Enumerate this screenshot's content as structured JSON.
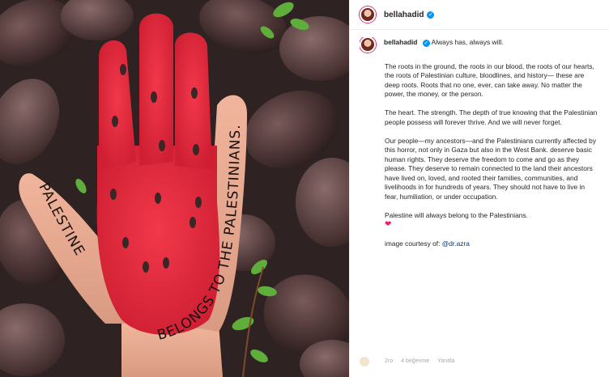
{
  "post": {
    "username": "bellahadid",
    "verified_glyph": "✓",
    "caption_intro": "Always has, always will.",
    "paragraphs": [
      "The roots in the ground, the roots in our blood, the roots of our hearts, the roots of Palestinian culture, bloodlines, and history— these are deep roots. Roots that no one, ever, can take away. No matter the power, the money, or the person.",
      "The heart. The strength. The depth of true knowing that the Palestinian people possess will forever thrive. And we will never forget.",
      "Our people—my ancestors—and the Palestinians currently affected by this horror, not only in Gaza but also in the West Bank. deserve basic human rights. They deserve the freedom to come and go as they please. They deserve to remain connected to the land their ancestors have lived on, loved, and rooted their families, communities, and livelihoods in for hundreds of years. They should not have to live in fear, humiliation, or under occupation.",
      "Palestine will always belong to the Palestinians."
    ],
    "heart_glyph": "❤",
    "credit_prefix": "image courtesy of: ",
    "credit_mention": "@dr.azra",
    "footer": {
      "time": "2ro",
      "likes": "4 beğenme",
      "reply": "Yanıtla"
    }
  },
  "photo": {
    "hand_text": "PALESTINE BELONGS TO THE PALESTINIANS."
  },
  "icons": {
    "verified": "verified-badge-icon",
    "heart": "heart-icon"
  },
  "colors": {
    "hand_red": "#e8263a",
    "verified_blue": "#0095f6",
    "leaf_dark": "#4a3333"
  }
}
